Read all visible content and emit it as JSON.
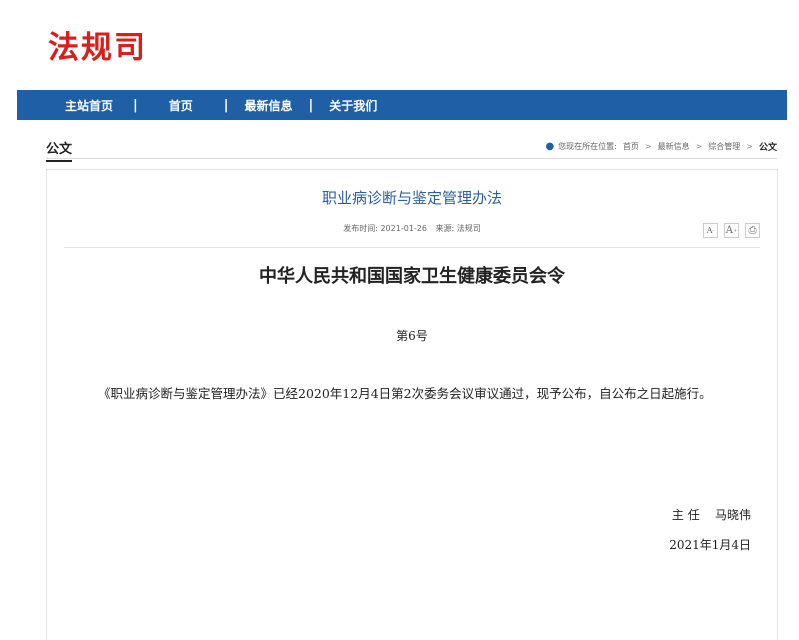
{
  "site": {
    "logo_text": "法规司"
  },
  "nav": {
    "items": [
      "主站首页",
      "首页",
      "最新信息",
      "关于我们"
    ],
    "separator": "|"
  },
  "section": {
    "title": "公文"
  },
  "breadcrumb": {
    "prefix": "您现在所在位置:",
    "items": [
      "首页",
      "最新信息",
      "综合管理"
    ],
    "current": "公文",
    "arrow": ">"
  },
  "article": {
    "title": "职业病诊断与鉴定管理办法",
    "meta_date": "发布时间: 2021-01-26",
    "meta_source": "来源: 法规司",
    "tools": {
      "font_small": "A",
      "font_large": "A",
      "print": "⎙"
    },
    "order_title": "中华人民共和国国家卫生健康委员会令",
    "order_number": "第6号",
    "body": "《职业病诊断与鉴定管理办法》已经2020年12月4日第2次委务会议审议通过，现予公布，自公布之日起施行。",
    "signer": "主 任    马晓伟",
    "sign_date": "2021年1月4日"
  }
}
